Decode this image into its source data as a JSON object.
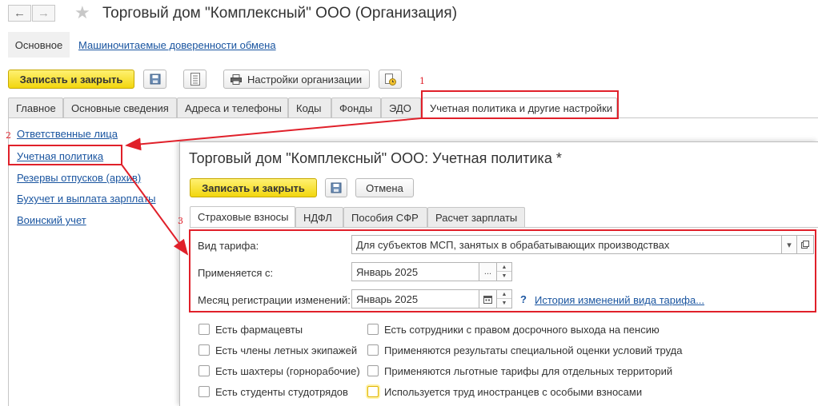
{
  "window": {
    "title": "Торговый дом \"Комплексный\" ООО (Организация)",
    "back_icon": "arrow-left-icon",
    "forward_icon": "arrow-right-icon",
    "favorite_icon": "star-icon"
  },
  "top_nav": {
    "main_label": "Основное",
    "link_label": "Машиночитаемые доверенности обмена"
  },
  "toolbar": {
    "save_close_label": "Записать и закрыть",
    "settings_label": "Настройки организации"
  },
  "main_tabs": [
    {
      "label": "Главное"
    },
    {
      "label": "Основные сведения"
    },
    {
      "label": "Адреса и телефоны"
    },
    {
      "label": "Коды"
    },
    {
      "label": "Фонды"
    },
    {
      "label": "ЭДО"
    },
    {
      "label": "Учетная политика и другие настройки"
    }
  ],
  "sidebar": {
    "items": [
      {
        "label": "Ответственные лица"
      },
      {
        "label": "Учетная политика"
      },
      {
        "label": "Резервы отпусков (архив)"
      },
      {
        "label": "Бухучет и выплата зарплаты"
      },
      {
        "label": "Воинский учет"
      }
    ]
  },
  "annotations": {
    "n1": "1",
    "n2": "2",
    "n3": "3",
    "color": "#e0202a"
  },
  "dialog": {
    "title": "Торговый дом \"Комплексный\" ООО: Учетная политика *",
    "save_close_label": "Записать и закрыть",
    "cancel_label": "Отмена",
    "tabs": [
      {
        "label": "Страховые взносы"
      },
      {
        "label": "НДФЛ"
      },
      {
        "label": "Пособия СФР"
      },
      {
        "label": "Расчет зарплаты"
      }
    ],
    "tariff_label": "Вид тарифа:",
    "tariff_value": "Для субъектов МСП, занятых в обрабатывающих производствах",
    "applies_label": "Применяется с:",
    "applies_value": "Январь 2025",
    "reg_month_label": "Месяц регистрации изменений:",
    "reg_month_value": "Январь 2025",
    "help_mark": "?",
    "history_link": "История изменений вида тарифа...",
    "ellipsis": "...",
    "checkboxes_left": [
      {
        "label": "Есть фармацевты",
        "checked": false
      },
      {
        "label": "Есть члены летных экипажей",
        "checked": false
      },
      {
        "label": "Есть шахтеры (горнорабочие)",
        "checked": false
      },
      {
        "label": "Есть студенты студотрядов",
        "checked": false
      }
    ],
    "checkboxes_right": [
      {
        "label": "Есть сотрудники с правом досрочного выхода на пенсию",
        "checked": false
      },
      {
        "label": "Применяются результаты специальной оценки условий труда",
        "checked": false
      },
      {
        "label": "Применяются льготные тарифы для отдельных территорий",
        "checked": false
      },
      {
        "label": "Используется труд иностранцев с особыми взносами",
        "checked": false
      }
    ]
  }
}
